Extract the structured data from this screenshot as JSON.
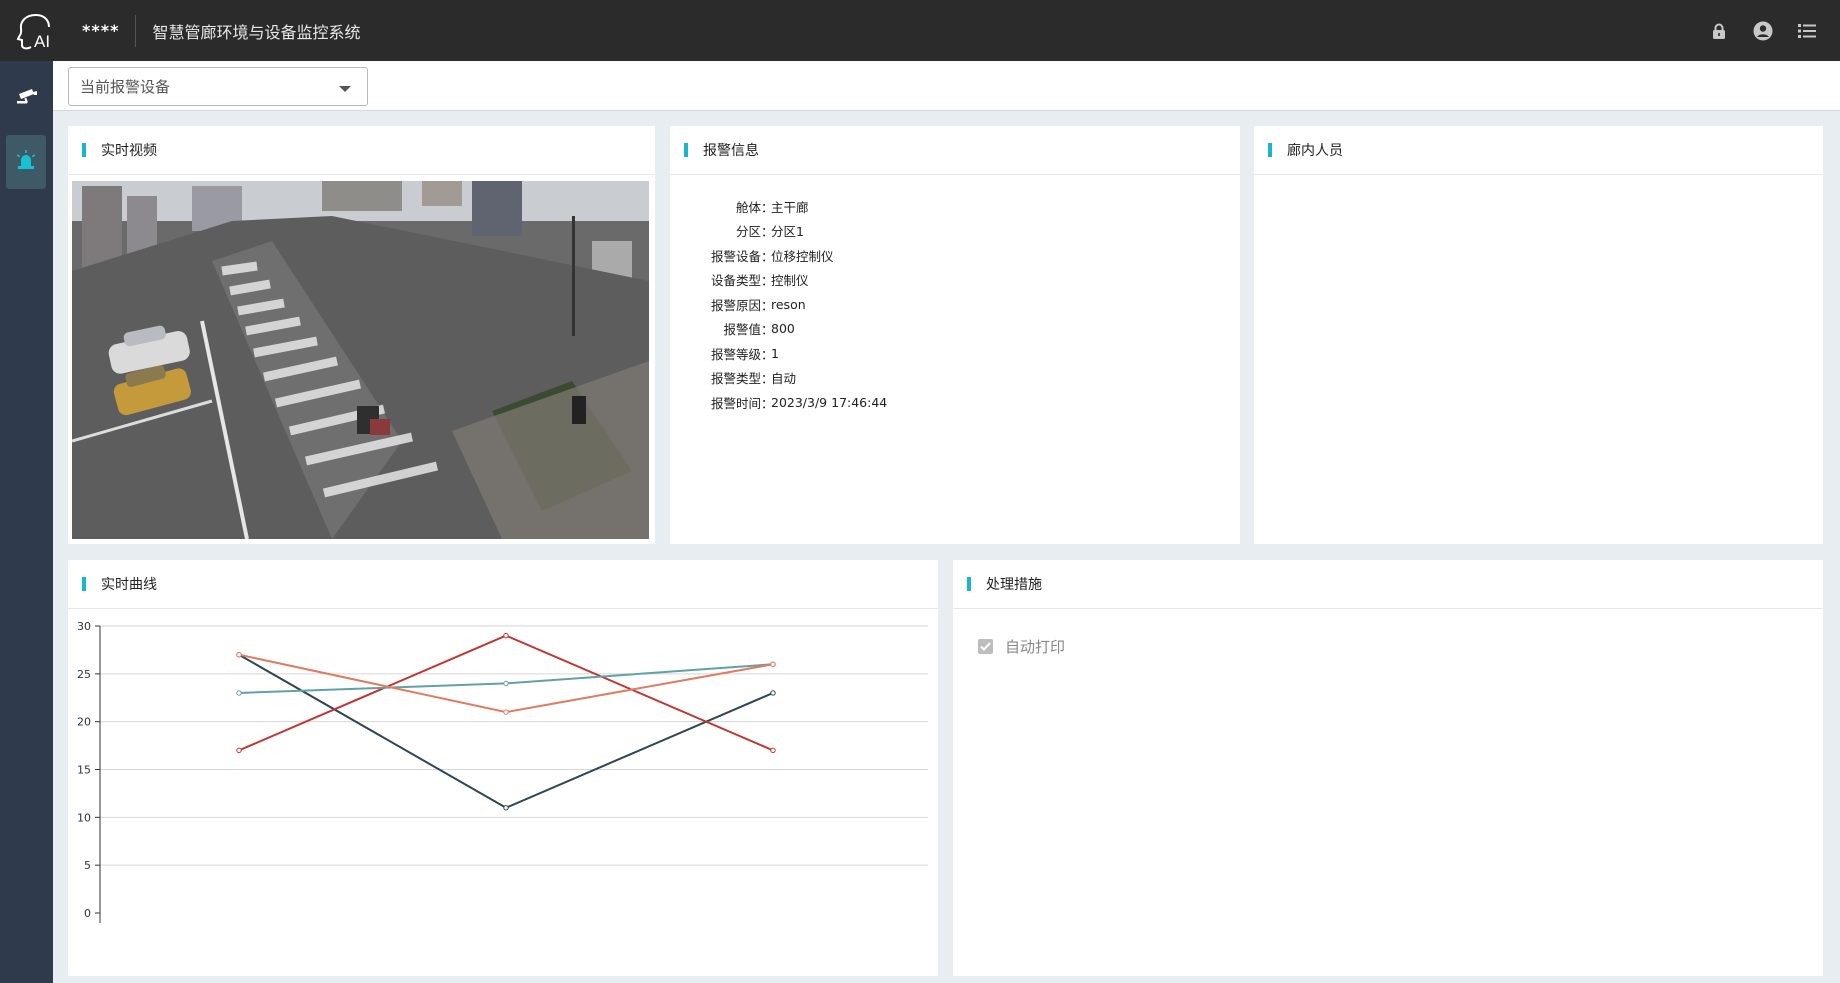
{
  "header": {
    "logo_text": "AI",
    "masked_user": "****",
    "app_title": "智慧管廊环境与设备监控系统",
    "icons": [
      "lock-icon",
      "user-circle-icon",
      "list-icon"
    ]
  },
  "sidebar": {
    "items": [
      {
        "icon": "camera-icon",
        "active": false
      },
      {
        "icon": "alarm-light-icon",
        "active": true
      }
    ]
  },
  "toolbar": {
    "select_value": "当前报警设备"
  },
  "panels": {
    "video": {
      "title": "实时视频"
    },
    "alarm_info": {
      "title": "报警信息",
      "rows": [
        {
          "label": "舱体",
          "value": "主干廊"
        },
        {
          "label": "分区",
          "value": "分区1"
        },
        {
          "label": "报警设备",
          "value": "位移控制仪"
        },
        {
          "label": "设备类型",
          "value": "控制仪"
        },
        {
          "label": "报警原因",
          "value": "reson"
        },
        {
          "label": "报警值",
          "value": "800"
        },
        {
          "label": "报警等级",
          "value": "1"
        },
        {
          "label": "报警类型",
          "value": "自动"
        },
        {
          "label": "报警时间",
          "value": "2023/3/9 17:46:44"
        }
      ]
    },
    "personnel": {
      "title": "廊内人员"
    },
    "curve": {
      "title": "实时曲线"
    },
    "measures": {
      "title": "处理措施",
      "checkbox_label": "自动打印",
      "checkbox_checked": true
    }
  },
  "chart_data": {
    "type": "line",
    "x": [
      1,
      2,
      3
    ],
    "ylim": [
      0,
      30
    ],
    "yticks": [
      0,
      5,
      10,
      15,
      20,
      25,
      30
    ],
    "grid": true,
    "series": [
      {
        "values": [
          27,
          11,
          23
        ],
        "color": "#2f4554"
      },
      {
        "values": [
          17,
          29,
          17
        ],
        "color": "#c23531"
      },
      {
        "values": [
          23,
          24,
          26
        ],
        "color": "#61a0a8"
      },
      {
        "values": [
          27,
          21,
          26
        ],
        "color": "#e07b5f"
      }
    ]
  }
}
